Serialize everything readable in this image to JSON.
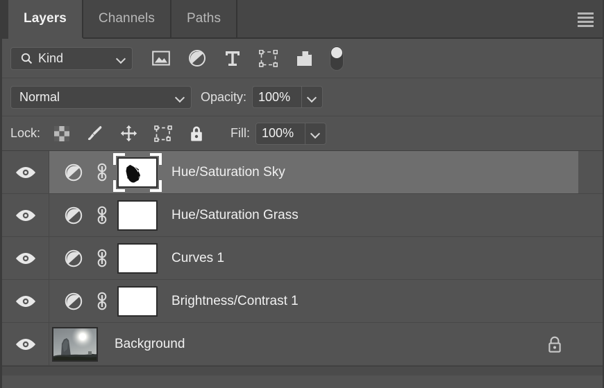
{
  "panel": {
    "title": "Layers",
    "menu_icon": "hamburger-menu-icon",
    "colors": {
      "panel_bg": "#535353",
      "tab_inactive_bg": "#464646",
      "selected_row_bg": "#6e6e6e",
      "field_bg": "#454545",
      "text": "#f0f0f0"
    }
  },
  "tabs": [
    {
      "label": "Layers",
      "active": true
    },
    {
      "label": "Channels",
      "active": false
    },
    {
      "label": "Paths",
      "active": false
    }
  ],
  "filter_bar": {
    "search_icon": "search-icon",
    "kind_value": "Kind",
    "kind_placeholder": "Kind",
    "dropdown_icon": "chevron-down-icon",
    "filter_icons": [
      "pixel-layer-filter-icon",
      "adjustment-layer-filter-icon",
      "type-layer-filter-icon",
      "shape-layer-filter-icon",
      "smart-object-filter-icon"
    ],
    "toggle_icon": "filter-enable-toggle",
    "toggle_state": "off"
  },
  "blend_bar": {
    "blend_mode": "Normal",
    "opacity_label": "Opacity:",
    "opacity_value": "100%",
    "dropdown_icon": "chevron-down-icon"
  },
  "lock_bar": {
    "lock_label": "Lock:",
    "lock_icons": [
      "lock-transparent-pixels-icon",
      "lock-image-pixels-icon",
      "lock-position-icon",
      "lock-artboard-nesting-icon",
      "lock-all-icon"
    ],
    "fill_label": "Fill:",
    "fill_value": "100%"
  },
  "layers": [
    {
      "name": "Hue/Saturation Sky",
      "visible": true,
      "visibility_icon": "eye-icon",
      "type_icon": "adjustment-layer-icon",
      "link_icon": "link-mask-icon",
      "thumb": "mask",
      "mask_has_content": true,
      "selected": true,
      "mask_selected": true,
      "locked": false
    },
    {
      "name": "Hue/Saturation Grass",
      "visible": true,
      "visibility_icon": "eye-icon",
      "type_icon": "adjustment-layer-icon",
      "link_icon": "link-mask-icon",
      "thumb": "mask",
      "mask_has_content": false,
      "selected": false,
      "mask_selected": false,
      "locked": false
    },
    {
      "name": "Curves 1",
      "visible": true,
      "visibility_icon": "eye-icon",
      "type_icon": "adjustment-layer-icon",
      "link_icon": "link-mask-icon",
      "thumb": "mask",
      "mask_has_content": false,
      "selected": false,
      "mask_selected": false,
      "locked": false
    },
    {
      "name": "Brightness/Contrast 1",
      "visible": true,
      "visibility_icon": "eye-icon",
      "type_icon": "adjustment-layer-icon",
      "link_icon": "link-mask-icon",
      "thumb": "mask",
      "mask_has_content": false,
      "selected": false,
      "mask_selected": false,
      "locked": false
    },
    {
      "name": "Background",
      "visible": true,
      "visibility_icon": "eye-icon",
      "thumb": "photo",
      "photo_description": "landscape-photo-with-sun-and-rock",
      "selected": false,
      "locked": true,
      "lock_icon": "padlock-icon"
    }
  ]
}
